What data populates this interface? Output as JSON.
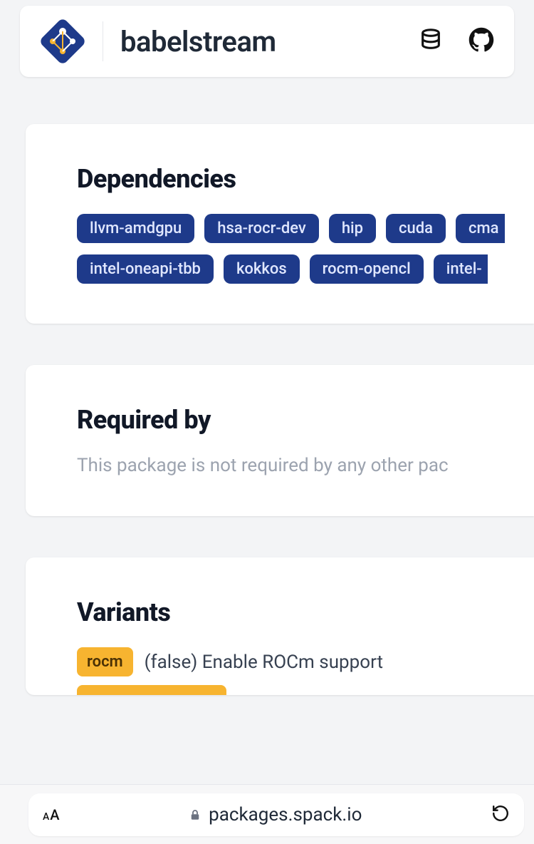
{
  "header": {
    "package_name": "babelstream"
  },
  "dependencies": {
    "title": "Dependencies",
    "row1": [
      "llvm-amdgpu",
      "hsa-rocr-dev",
      "hip",
      "cuda"
    ],
    "row1_cut": "cma",
    "row2": [
      "intel-oneapi-tbb",
      "kokkos",
      "rocm-opencl"
    ],
    "row2_cut": "intel-"
  },
  "required_by": {
    "title": "Required by",
    "text": "This package is not required by any other pac"
  },
  "variants": {
    "title": "Variants",
    "items": [
      {
        "name": "rocm",
        "default": "(false)",
        "desc": "Enable ROCm support"
      }
    ]
  },
  "browser": {
    "domain": "packages.spack.io"
  }
}
